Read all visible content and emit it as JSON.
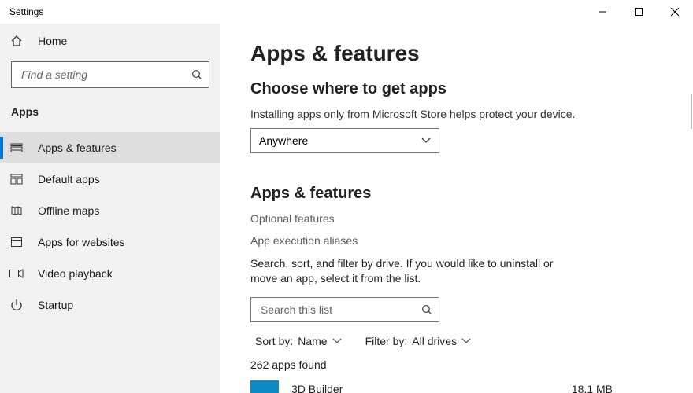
{
  "window_title": "Settings",
  "sidebar": {
    "home": "Home",
    "search_placeholder": "Find a setting",
    "section": "Apps",
    "items": [
      {
        "label": "Apps & features"
      },
      {
        "label": "Default apps"
      },
      {
        "label": "Offline maps"
      },
      {
        "label": "Apps for websites"
      },
      {
        "label": "Video playback"
      },
      {
        "label": "Startup"
      }
    ]
  },
  "main": {
    "title": "Apps & features",
    "choose_header": "Choose where to get apps",
    "choose_help": "Installing apps only from Microsoft Store helps protect your device.",
    "choose_value": "Anywhere",
    "apps_features_header": "Apps & features",
    "optional_features": "Optional features",
    "aliases": "App execution aliases",
    "search_help": "Search, sort, and filter by drive. If you would like to uninstall or move an app, select it from the list.",
    "list_search_placeholder": "Search this list",
    "sort_label": "Sort by:",
    "sort_value": "Name",
    "filter_label": "Filter by:",
    "filter_value": "All drives",
    "count_text": "262 apps found",
    "first_app": {
      "name": "3D Builder",
      "size": "18.1 MB"
    }
  }
}
